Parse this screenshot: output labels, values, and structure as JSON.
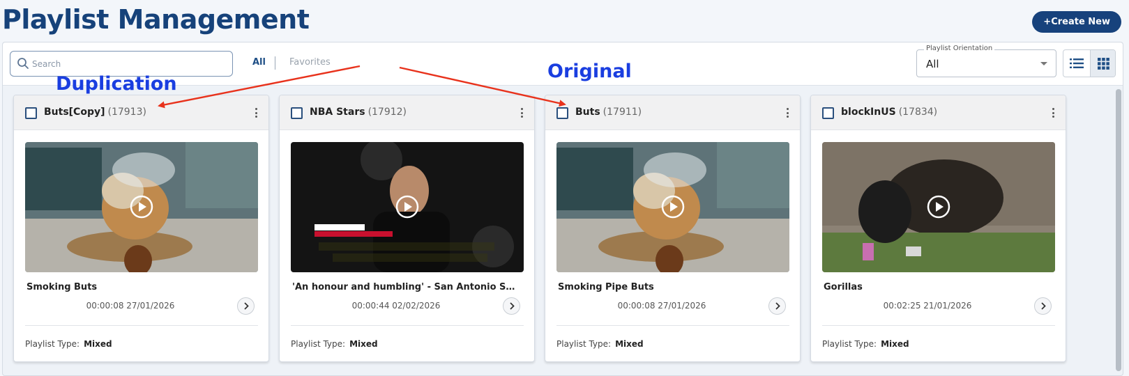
{
  "page": {
    "title": "Playlist Management",
    "create_label": "+Create New"
  },
  "toolbar": {
    "search_placeholder": "Search",
    "tabs": [
      "All",
      "Favorites"
    ],
    "orientation": {
      "label": "Playlist Orientation",
      "value": "All"
    },
    "active_view": "grid"
  },
  "annotations": {
    "duplication": "Duplication",
    "original": "Original"
  },
  "playlist_type_label": "Playlist Type:",
  "playlists": [
    {
      "name": "Buts[Copy]",
      "id": "(17913)",
      "video_title": "Smoking Buts",
      "meta": "00:00:08 27/01/2026",
      "type": "Mixed",
      "thumb": "dog"
    },
    {
      "name": "NBA Stars",
      "id": "(17912)",
      "video_title": "'An honour and humbling' - San Antonio Spurs'...",
      "meta": "00:00:44 02/02/2026",
      "type": "Mixed",
      "thumb": "nba"
    },
    {
      "name": "Buts",
      "id": "(17911)",
      "video_title": "Smoking Pipe Buts",
      "meta": "00:00:08 27/01/2026",
      "type": "Mixed",
      "thumb": "dog"
    },
    {
      "name": "blockInUS",
      "id": "(17834)",
      "video_title": "Gorillas",
      "meta": "00:02:25 21/01/2026",
      "type": "Mixed",
      "thumb": "gorilla"
    }
  ],
  "colors": {
    "brand": "#17427c",
    "annotation_text": "#1a3ee0",
    "annotation_arrow": "#e8321c"
  }
}
